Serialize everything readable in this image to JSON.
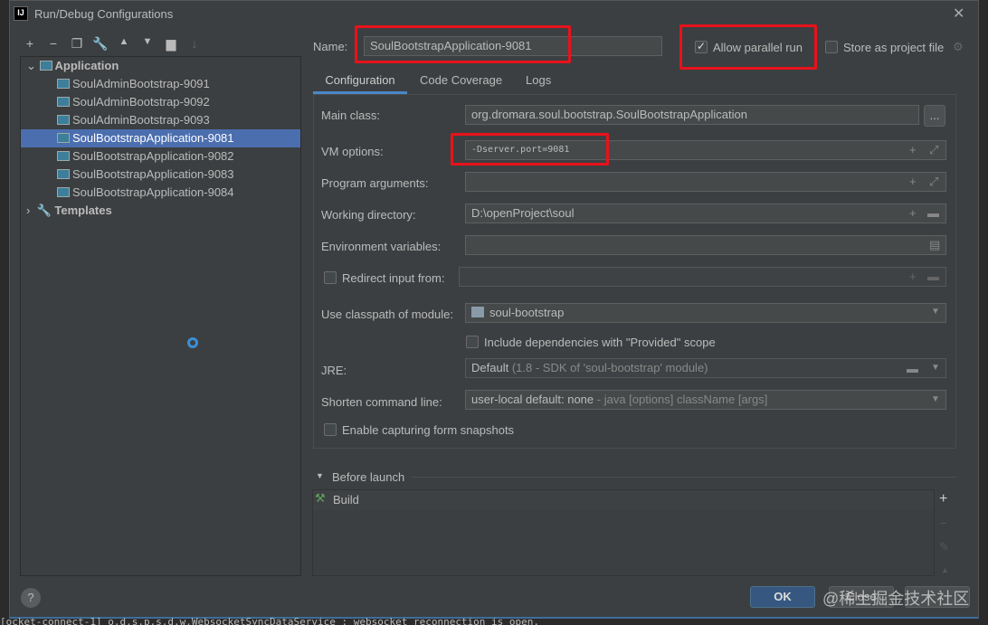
{
  "window": {
    "title": "Run/Debug Configurations",
    "logo": "IJ"
  },
  "toolbar": [
    "plus-icon",
    "minus-icon",
    "copy-icon",
    "wrench-icon",
    "arrow-up-icon",
    "arrow-down-icon",
    "folder-add-icon",
    "sort-icon"
  ],
  "tree": {
    "application": "Application",
    "items": [
      "SoulAdminBootstrap-9091",
      "SoulAdminBootstrap-9092",
      "SoulAdminBootstrap-9093",
      "SoulBootstrapApplication-9081",
      "SoulBootstrapApplication-9082",
      "SoulBootstrapApplication-9083",
      "SoulBootstrapApplication-9084"
    ],
    "selected": "SoulBootstrapApplication-9081",
    "templates": "Templates"
  },
  "name": {
    "label": "Name:",
    "value": "SoulBootstrapApplication-9081"
  },
  "allow_parallel": {
    "label": "Allow parallel run",
    "checked": true
  },
  "store_project": {
    "label": "Store as project file",
    "checked": false
  },
  "tabs": [
    "Configuration",
    "Code Coverage",
    "Logs"
  ],
  "form": {
    "main_class": {
      "label": "Main class:",
      "value": "org.dromara.soul.bootstrap.SoulBootstrapApplication",
      "button": "..."
    },
    "vm_options": {
      "label": "VM options:",
      "value": "-Dserver.port=9081"
    },
    "program_args": {
      "label": "Program arguments:",
      "value": ""
    },
    "working_dir": {
      "label": "Working directory:",
      "value": "D:\\openProject\\soul"
    },
    "env_vars": {
      "label": "Environment variables:",
      "value": ""
    },
    "redirect": {
      "label": "Redirect input from:",
      "value": "",
      "checked": false
    },
    "classpath": {
      "label": "Use classpath of module:",
      "value": "soul-bootstrap"
    },
    "include_deps": {
      "label": "Include dependencies with \"Provided\" scope",
      "checked": false
    },
    "jre": {
      "label": "JRE:",
      "value": "Default",
      "hint": "(1.8 - SDK of 'soul-bootstrap' module)"
    },
    "shorten": {
      "label": "Shorten command line:",
      "value": "user-local default: none",
      "hint": "- java [options] className [args]"
    },
    "snapshots": {
      "label": "Enable capturing form snapshots",
      "checked": false
    }
  },
  "before_launch": {
    "label": "Before launch",
    "items": [
      "Build"
    ]
  },
  "buttons": {
    "ok": "OK",
    "close": "Close",
    "help": "?"
  },
  "watermark": "@稀土掘金技术社区",
  "console": "[ocket-connect-1] o.d.s.p.s.d.w.WebsocketSyncDataService : websocket reconnection is open."
}
